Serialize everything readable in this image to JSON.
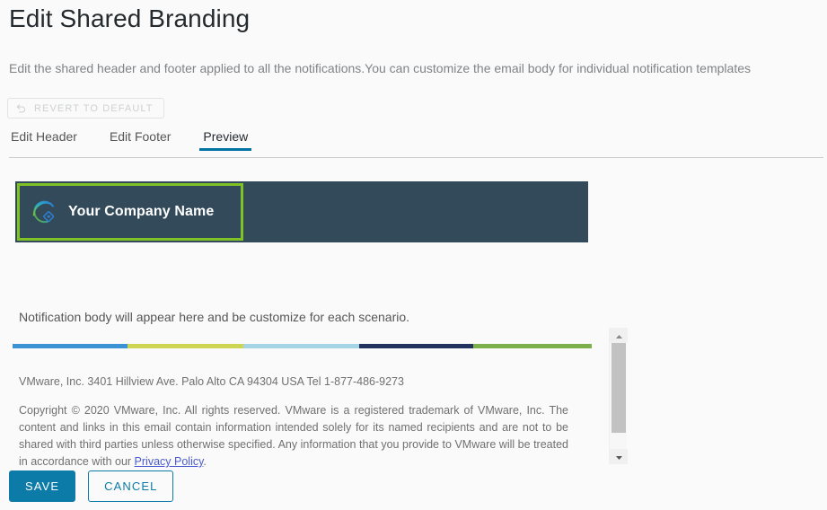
{
  "page": {
    "title": "Edit Shared Branding",
    "description": "Edit the shared header and footer applied to all the notifications.You can customize the email body for individual notification templates"
  },
  "revert": {
    "label": "REVERT TO DEFAULT",
    "icon": "undo-arrow-icon",
    "disabled": true
  },
  "tabs": [
    {
      "label": "Edit Header",
      "active": false
    },
    {
      "label": "Edit Footer",
      "active": false
    },
    {
      "label": "Preview",
      "active": true
    }
  ],
  "preview": {
    "banner": {
      "background_color": "#324a5a",
      "highlight_border_color": "#7ec225",
      "logo_icon": "company-logo-icon",
      "company_name": "Your Company Name"
    },
    "body_text": "Notification body will appear here and be customize for each scenario.",
    "color_bar": [
      {
        "color": "#3b93d3",
        "width_pct": 19.9
      },
      {
        "color": "#cdd553",
        "width_pct": 20.0
      },
      {
        "color": "#a4d4e6",
        "width_pct": 20.0
      },
      {
        "color": "#22325f",
        "width_pct": 19.7
      },
      {
        "color": "#7cb04a",
        "width_pct": 20.4
      }
    ],
    "footer_address": "VMware, Inc. 3401 Hillview Ave. Palo Alto CA 94304 USA Tel 1-877-486-9273",
    "copyright_before_link": "Copyright © 2020 VMware, Inc. All rights reserved. VMware is a registered trademark of VMware, Inc. The content and links in this email contain information intended solely for its named recipients and are not to be shared with third parties unless otherwise specified. Any information that you provide to VMware will be treated in accordance with our ",
    "copyright_link": "Privacy Policy",
    "copyright_after_link": ".",
    "link_color": "#4a5bd0"
  },
  "scrollbar": {
    "up_arrow": "chevron-up-icon",
    "down_arrow": "chevron-down-icon",
    "thumb_color": "#c2c2c2"
  },
  "actions": {
    "save_label": "SAVE",
    "cancel_label": "CANCEL",
    "primary_color": "#0d7ba8"
  }
}
